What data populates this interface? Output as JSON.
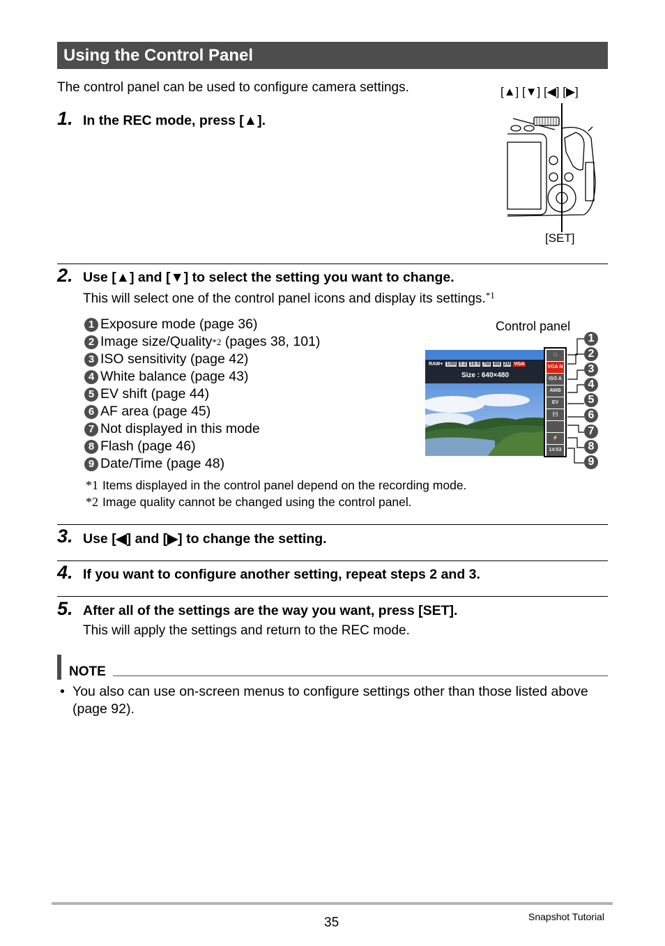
{
  "header": {
    "title": "Using the Control Panel"
  },
  "intro": "The control panel can be used to configure camera settings.",
  "camera_figure": {
    "button_labels": "[▲] [▼] [◀] [▶]",
    "set_label": "[SET]"
  },
  "steps": [
    {
      "number": "1.",
      "title": "In the REC mode, press [▲]."
    },
    {
      "number": "2.",
      "title": "Use [▲] and [▼] to select the setting you want to change.",
      "body": "This will select one of the control panel icons and display its settings.",
      "body_footnote": "*1"
    },
    {
      "number": "3.",
      "title": "Use [◀] and [▶] to change the setting."
    },
    {
      "number": "4.",
      "title": "If you want to configure another setting, repeat steps 2 and 3."
    },
    {
      "number": "5.",
      "title": "After all of the settings are the way you want, press [SET].",
      "body": "This will apply the settings and return to the REC mode."
    }
  ],
  "settings_list": [
    {
      "num": "1",
      "label": "Exposure mode (page 36)"
    },
    {
      "num": "2",
      "label": "Image size/Quality",
      "footnote": "*2",
      "suffix": " (pages 38, 101)"
    },
    {
      "num": "3",
      "label": "ISO sensitivity (page 42)"
    },
    {
      "num": "4",
      "label": "White balance (page 43)"
    },
    {
      "num": "5",
      "label": "EV shift (page 44)"
    },
    {
      "num": "6",
      "label": "AF area (page 45)"
    },
    {
      "num": "7",
      "label": "Not displayed in this mode"
    },
    {
      "num": "8",
      "label": "Flash (page 46)"
    },
    {
      "num": "9",
      "label": "Date/Time (page 48)"
    }
  ],
  "control_panel_figure": {
    "label": "Control panel",
    "size_readout": "Size : 640×480",
    "size_options": [
      "RAW+",
      "10M",
      "3:2",
      "16:9",
      "7M",
      "4M",
      "2M",
      "VGA"
    ],
    "panel_icons": [
      "□",
      "VGA N",
      "ISO A",
      "AWB",
      "EV",
      "[•]",
      "",
      "⚡",
      "14:53"
    ],
    "callouts": [
      "1",
      "2",
      "3",
      "4",
      "5",
      "6",
      "7",
      "8",
      "9"
    ]
  },
  "footnotes": [
    {
      "mark": "*1",
      "text": "Items displayed in the control panel depend on the recording mode."
    },
    {
      "mark": "*2",
      "text": "Image quality cannot be changed using the control panel."
    }
  ],
  "note": {
    "label": "NOTE",
    "bullet": "•",
    "text": "You also can use on-screen menus to configure settings other than those listed above (page 92)."
  },
  "footer": {
    "page_number": "35",
    "section": "Snapshot Tutorial"
  }
}
